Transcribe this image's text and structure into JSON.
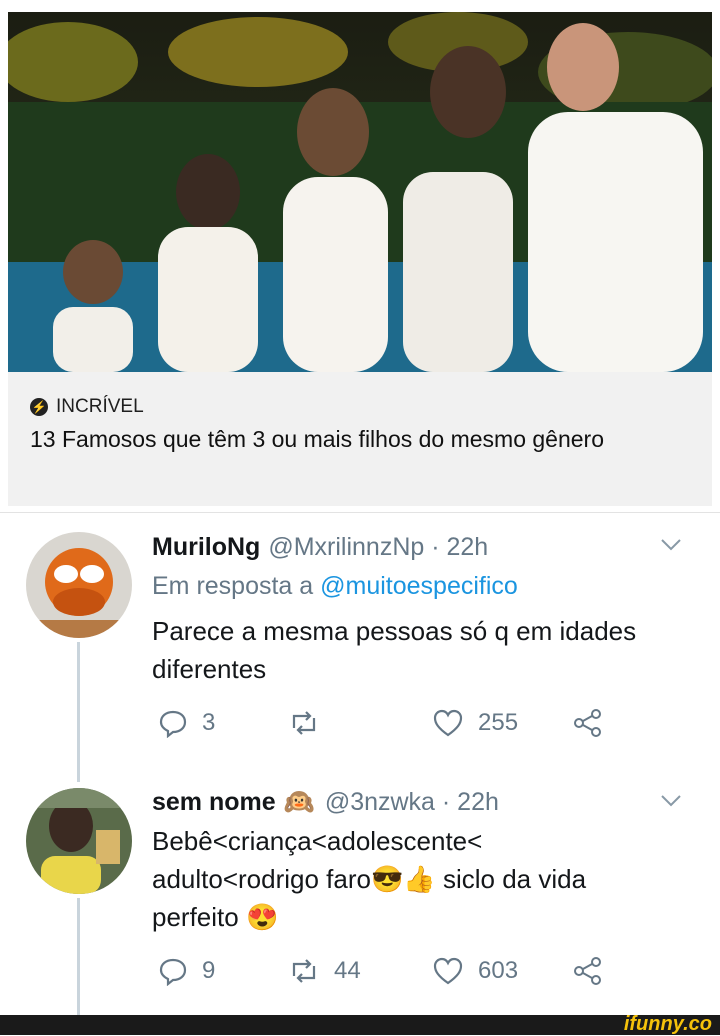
{
  "card": {
    "tag": "INCRÍVEL",
    "title": "13 Famosos que têm 3 ou mais filhos do mesmo gênero"
  },
  "tweets": [
    {
      "name": "MuriloNg",
      "handle": "@MxrilinnzNp · 22h",
      "reply_prefix": "Em resposta a ",
      "reply_to": "@muitoespecifico",
      "text": "Parece a mesma pessoas só q em idades diferentes",
      "replies": "3",
      "retweets": "",
      "likes": "255"
    },
    {
      "name": "sem nome",
      "name_emoji": "🙉",
      "handle": "@3nzwka · 22h",
      "text_line1": "Bebê<criança<adolescente<",
      "text_line2": "adulto<rodrigo faro😎👍 siclo da vida",
      "text_line3": "perfeito 😍",
      "replies": "9",
      "retweets": "44",
      "likes": "603"
    }
  ],
  "footer": {
    "logo": "ifunny.co"
  },
  "icons": [
    "lightning-icon",
    "chevron-down-icon",
    "reply-icon",
    "retweet-icon",
    "like-icon",
    "share-icon"
  ]
}
